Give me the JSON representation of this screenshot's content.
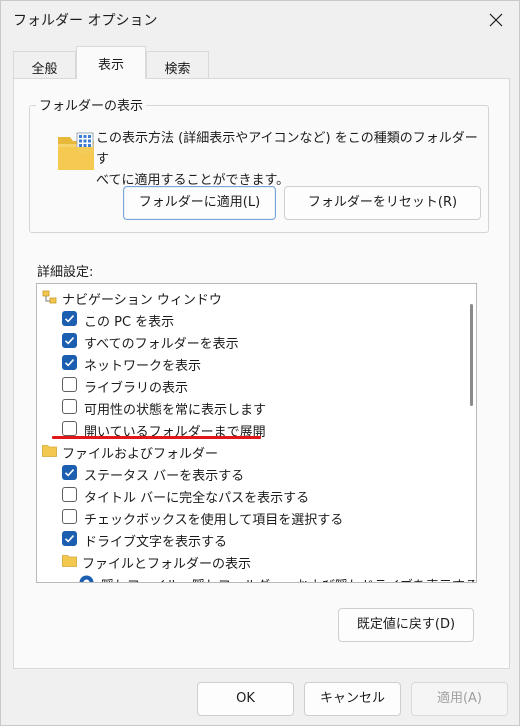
{
  "window": {
    "title": "フォルダー オプション"
  },
  "tabs": [
    {
      "label": "全般"
    },
    {
      "label": "表示"
    },
    {
      "label": "検索"
    }
  ],
  "folder_view": {
    "label": "フォルダーの表示",
    "description_line1": "この表示方法 (詳細表示やアイコンなど) をこの種類のフォルダーす",
    "description_line2": "べてに適用することができます。",
    "apply_label": "フォルダーに適用(L)",
    "reset_label": "フォルダーをリセット(R)"
  },
  "advanced": {
    "label": "詳細設定:",
    "items": [
      {
        "label": "ナビゲーション ウィンドウ",
        "kind": "group",
        "icon": "navigation-pane-icon"
      },
      {
        "label": "この PC を表示",
        "kind": "checkbox",
        "checked": true
      },
      {
        "label": "すべてのフォルダーを表示",
        "kind": "checkbox",
        "checked": true
      },
      {
        "label": "ネットワークを表示",
        "kind": "checkbox",
        "checked": true
      },
      {
        "label": "ライブラリの表示",
        "kind": "checkbox",
        "checked": false
      },
      {
        "label": "可用性の状態を常に表示します",
        "kind": "checkbox",
        "checked": false
      },
      {
        "label": "開いているフォルダーまで展開",
        "kind": "checkbox",
        "checked": false
      },
      {
        "label": "ファイルおよびフォルダー",
        "kind": "group",
        "icon": "folder-icon"
      },
      {
        "label": "ステータス バーを表示する",
        "kind": "checkbox",
        "checked": true
      },
      {
        "label": "タイトル バーに完全なパスを表示する",
        "kind": "checkbox",
        "checked": false
      },
      {
        "label": "チェックボックスを使用して項目を選択する",
        "kind": "checkbox",
        "checked": false
      },
      {
        "label": "ドライブ文字を表示する",
        "kind": "checkbox",
        "checked": true
      },
      {
        "label": "ファイルとフォルダーの表示",
        "kind": "group",
        "icon": "folder-icon"
      },
      {
        "label": "隠しファイル、隠しフォルダー、および隠しドライブを表示する",
        "kind": "radio",
        "checked": true
      }
    ],
    "restore_label": "既定値に戻す(D)"
  },
  "footer": {
    "ok_label": "OK",
    "cancel_label": "キャンセル",
    "apply_label": "適用(A)"
  },
  "colors": {
    "accent": "#1c5fb0",
    "highlight_underline": "#e21818"
  }
}
